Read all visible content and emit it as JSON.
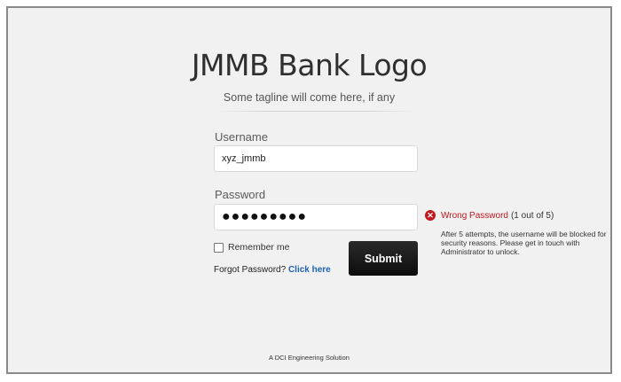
{
  "brand": {
    "logo_text": "JMMB Bank Logo",
    "tagline": "Some tagline will come here, if any"
  },
  "form": {
    "username_label": "Username",
    "username_value": "xyz_jmmb",
    "password_label": "Password",
    "password_masked": "●●●●●●●●●",
    "remember_label": "Remember me",
    "forgot_prefix": "Forgot Password?",
    "forgot_link": "Click here",
    "submit_label": "Submit"
  },
  "error": {
    "icon": "error-x-icon",
    "icon_glyph": "✕",
    "title": "Wrong Password",
    "count": "(1 out of 5)",
    "detail": "After 5 attempts, the username will be blocked for security reasons. Please get in touch with Administrator to unlock.",
    "color": "#c0181e"
  },
  "footer": {
    "text": "A DCI Engineering Solution"
  },
  "colors": {
    "background": "#f1f1f1",
    "link": "#1e62b0",
    "button": "#111111"
  }
}
